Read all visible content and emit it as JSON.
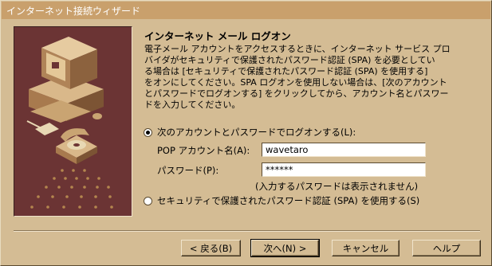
{
  "window": {
    "title": "インターネット接続ウィザード"
  },
  "page": {
    "heading": "インターネット メール ログオン",
    "description": "電子メール アカウントをアクセスするときに、インターネット サービス プロ\nバイダがセキュリティで保護されたパスワード認証 (SPA) を必要としてい\nる場合は [セキュリティで保護されたパスワード認証 (SPA) を使用する]\nをオンにしてください。SPA ログオンを使用しない場合は、[次のアカウント\nとパスワードでログオンする] をクリックしてから、アカウント名とパスワー\nドを入力してください。"
  },
  "logon": {
    "option_password": "次のアカウントとパスワードでログオンする(L):",
    "option_password_selected": true,
    "account_label": "POP アカウント名(A):",
    "account_value": "wavetaro",
    "password_label": "パスワード(P):",
    "password_value": "******",
    "password_note": "(入力するパスワードは表示されません)",
    "option_spa": "セキュリティで保護されたパスワード認証 (SPA) を使用する(S)",
    "option_spa_selected": false
  },
  "buttons": {
    "back": "< 戻る(B)",
    "next": "次へ(N) >",
    "cancel": "キャンセル",
    "help": "ヘルプ"
  },
  "colors": {
    "dialog": "#d4bc94",
    "titlebar": "#c9a06c",
    "illustration_bg": "#6b3434"
  },
  "icons": {
    "illustration": "computer-and-telephone-illustration"
  }
}
